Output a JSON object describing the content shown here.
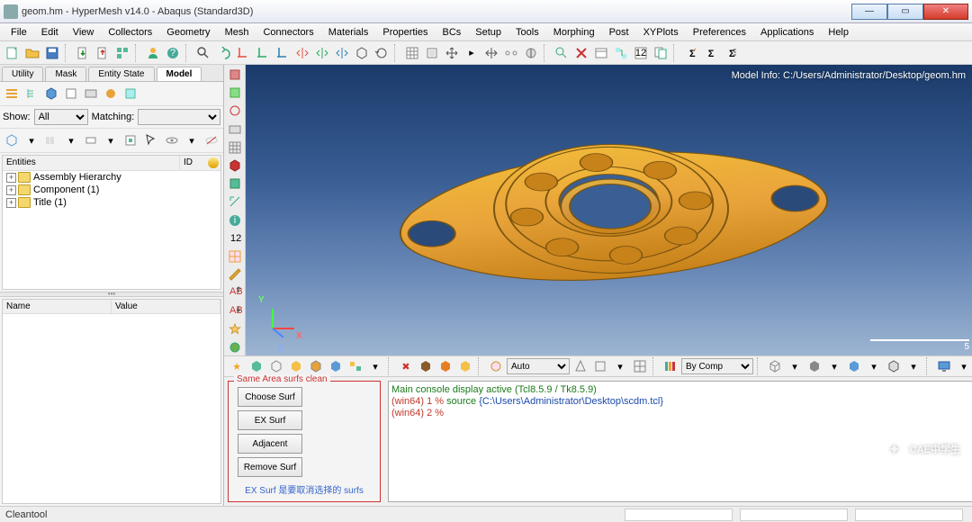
{
  "window": {
    "title": "geom.hm - HyperMesh v14.0 - Abaqus (Standard3D)"
  },
  "menu": [
    "File",
    "Edit",
    "View",
    "Collectors",
    "Geometry",
    "Mesh",
    "Connectors",
    "Materials",
    "Properties",
    "BCs",
    "Setup",
    "Tools",
    "Morphing",
    "Post",
    "XYPlots",
    "Preferences",
    "Applications",
    "Help"
  ],
  "left_tabs": {
    "items": [
      "Utility",
      "Mask",
      "Entity State",
      "Model"
    ],
    "active": 3
  },
  "filters": {
    "show_label": "Show:",
    "show_value": "All",
    "matching_label": "Matching:",
    "matching_value": ""
  },
  "tree": {
    "col_entities": "Entities",
    "col_id": "ID",
    "items": [
      {
        "label": "Assembly Hierarchy"
      },
      {
        "label": "Component (1)"
      },
      {
        "label": "Title (1)"
      }
    ]
  },
  "props": {
    "col_name": "Name",
    "col_value": "Value"
  },
  "viewport": {
    "model_info": "Model Info: C:/Users/Administrator/Desktop/geom.hm",
    "axis_x": "X",
    "axis_y": "Y",
    "axis_z": "Z",
    "scale": "5",
    "render_mode": "Auto",
    "by_mode": "By Comp"
  },
  "dialog": {
    "title": "Same Area surfs clean",
    "choose": "Choose Surf",
    "ex": "EX Surf",
    "adjacent": "Adjacent",
    "remove": "Remove Surf",
    "note": "EX Surf 是要取消选择的 surfs"
  },
  "console": {
    "line1": "Main console display active (Tcl8.5.9 / Tk8.5.9)",
    "line2_prompt": "(win64) 1 % ",
    "line2_cmd": "source",
    "line2_arg": " {C:\\Users\\Administrator\\Desktop\\scdm.tcl}",
    "line3": "(win64) 2 % "
  },
  "status": {
    "text": "Cleantool"
  },
  "watermark": "CAE中学生"
}
